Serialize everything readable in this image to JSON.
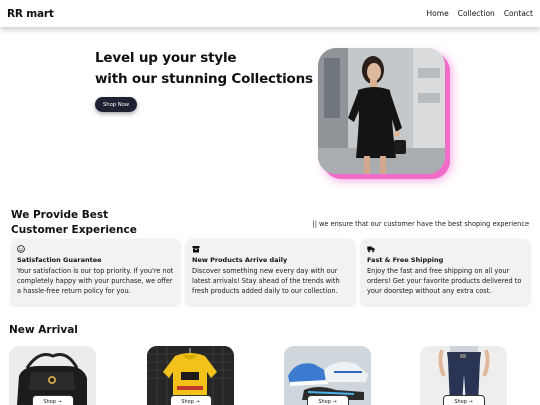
{
  "nav": {
    "brand": "RR mart",
    "links": [
      "Home",
      "Collection",
      "Contact"
    ]
  },
  "hero": {
    "heading_line1": "Level up your style",
    "heading_line2": "with our stunning Collections",
    "cta_label": "Shop Now"
  },
  "features": {
    "heading_line1": "We Provide Best",
    "heading_line2": "Customer Experience",
    "tagline": "|| we ensure that our customer have the best shoping experience",
    "cards": [
      {
        "icon": "smile-icon",
        "title": "Satisfaction Guarantee",
        "text": "Your satisfaction is our top priority. If you're not completely happy with your purchase, we offer a hassle-free return policy for you."
      },
      {
        "icon": "box-icon",
        "title": "New Products Arrive daily",
        "text": "Discover something new every day with our latest arrivals! Stay ahead of the trends with fresh products added daily to our collection."
      },
      {
        "icon": "truck-icon",
        "title": "Fast & Free Shipping",
        "text": "Enjoy the fast and free shipping on all your orders! Get your favorite products delivered to your doorstep without any extra cost."
      }
    ]
  },
  "arrivals": {
    "heading": "New Arrival",
    "shop_label": "Shop →"
  },
  "colors": {
    "accent_button": "#1f2233",
    "photo_glow": "#f06cc8",
    "card_bg": "#f1f2f4"
  }
}
